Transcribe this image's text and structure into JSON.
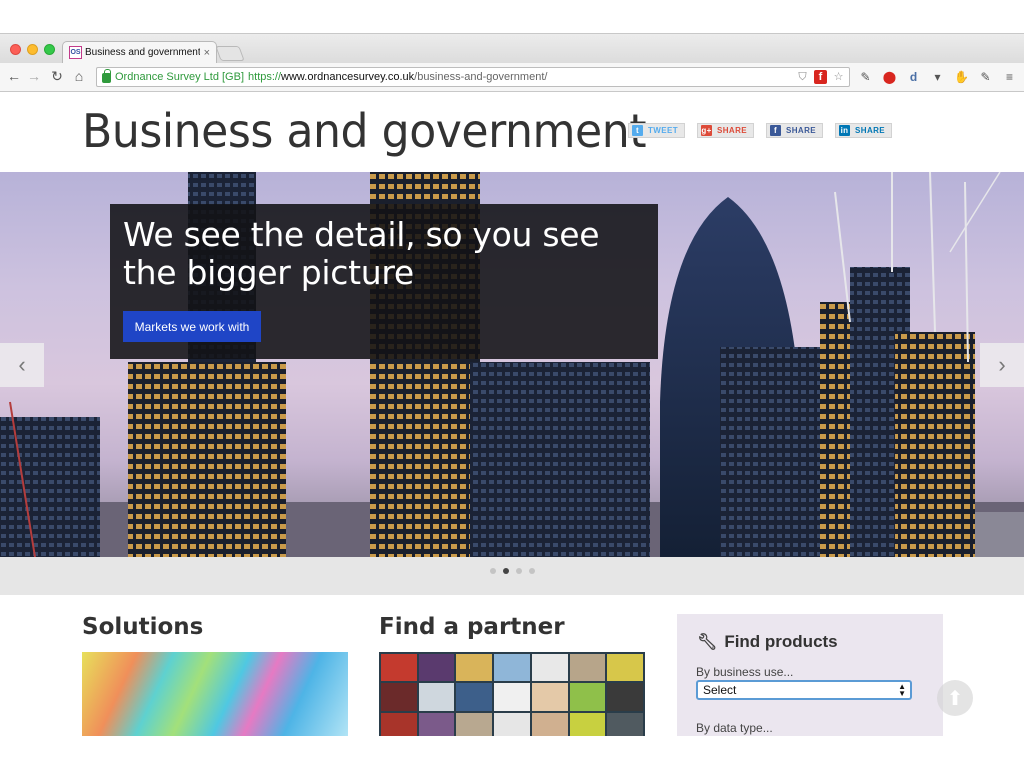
{
  "browser": {
    "tab_title": "Business and government",
    "tab_close": "×",
    "favicon_text": "OS",
    "omnibox": {
      "ev_org": "Ordnance Survey Ltd [GB]",
      "scheme": "https://",
      "host": "www.ordnancesurvey.co.uk",
      "path": "/business-and-government/"
    },
    "nav": {
      "back": "←",
      "forward": "→",
      "reload": "↻",
      "home": "⌂"
    },
    "colors": {
      "ev_green": "#2f9a3c",
      "close_red": "#fc5f57",
      "minimize_yellow": "#fdbc2e",
      "zoom_green": "#34c84a"
    }
  },
  "page": {
    "title": "Business and government",
    "share_buttons": [
      {
        "label": "TWEET",
        "icon": "twitter-icon",
        "glyph": "t",
        "icon_color": "#55acee",
        "text_color": "#55acee"
      },
      {
        "label": "SHARE",
        "icon": "google-plus-icon",
        "glyph": "g+",
        "icon_color": "#dd4b39",
        "text_color": "#dd4b39"
      },
      {
        "label": "SHARE",
        "icon": "facebook-icon",
        "glyph": "f",
        "icon_color": "#3b5998",
        "text_color": "#3b5998"
      },
      {
        "label": "SHARE",
        "icon": "linkedin-icon",
        "glyph": "in",
        "icon_color": "#0077b5",
        "text_color": "#0077b5"
      }
    ],
    "hero": {
      "headline": "We see the detail, so you see the bigger picture",
      "cta": "Markets we work with",
      "prev_arrow": "‹",
      "next_arrow": "›",
      "slides": 4,
      "active_slide": 2,
      "cta_color": "#1f45c6"
    },
    "solutions": {
      "title": "Solutions"
    },
    "partner": {
      "title": "Find a partner"
    },
    "finder": {
      "title": "Find products",
      "by_business_label": "By business use...",
      "select_value": "Select",
      "by_data_label": "By data type..."
    },
    "back_to_top": "⬆"
  }
}
